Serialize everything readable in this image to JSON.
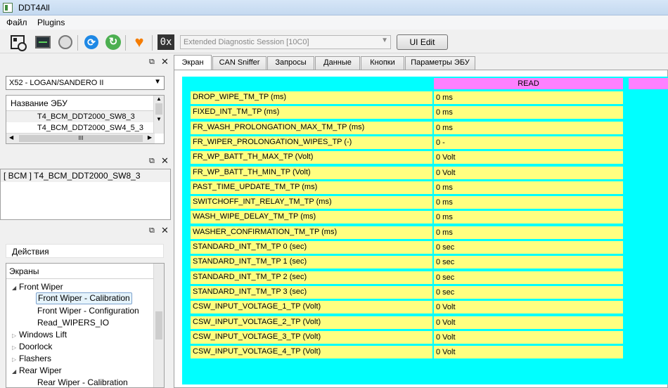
{
  "window": {
    "title": "DDT4All"
  },
  "menu": {
    "file": "Файл",
    "plugins": "Plugins"
  },
  "toolbar": {
    "session_value": "Extended Diagnostic Session [10C0]",
    "ui_edit_label": "UI Edit",
    "hex_label": "0x"
  },
  "vehicle": {
    "selected": "X52 - LOGAN/SANDERO II"
  },
  "ecu_list": {
    "header": "Название ЭБУ",
    "items": [
      "T4_BCM_DDT2000_SW8_3",
      "T4_BCM_DDT2000_SW4_5_3"
    ]
  },
  "scroll_glyph": "III",
  "connected": {
    "label": "[ BCM ] T4_BCM_DDT2000_SW8_3"
  },
  "actions": {
    "tab_label": "Действия",
    "tree_header": "Экраны",
    "tree": [
      "Front Wiper",
      "Front Wiper - Calibration",
      "Front Wiper - Configuration",
      "Read_WIPERS_IO",
      "Windows Lift",
      "Doorlock",
      "Flashers",
      "Rear Wiper",
      "Rear Wiper - Calibration"
    ]
  },
  "tabs": [
    "Экран",
    "CAN Sniffer",
    "Запросы",
    "Данные",
    "Кнопки",
    "Параметры ЭБУ"
  ],
  "screen": {
    "read_label": "READ",
    "params": [
      {
        "label": "DROP_WIPE_TM_TP (ms)",
        "value": "0 ms"
      },
      {
        "label": "FIXED_INT_TM_TP (ms)",
        "value": "0 ms"
      },
      {
        "label": "FR_WASH_PROLONGATION_MAX_TM_TP (ms)",
        "value": "0 ms"
      },
      {
        "label": "FR_WIPER_PROLONGATION_WIPES_TP (-)",
        "value": "0 -"
      },
      {
        "label": "FR_WP_BATT_TH_MAX_TP (Volt)",
        "value": "0 Volt"
      },
      {
        "label": "FR_WP_BATT_TH_MIN_TP (Volt)",
        "value": "0 Volt"
      },
      {
        "label": "PAST_TIME_UPDATE_TM_TP (ms)",
        "value": "0 ms"
      },
      {
        "label": "SWITCHOFF_INT_RELAY_TM_TP (ms)",
        "value": "0 ms"
      },
      {
        "label": "WASH_WIPE_DELAY_TM_TP (ms)",
        "value": "0 ms"
      },
      {
        "label": "WASHER_CONFIRMATION_TM_TP (ms)",
        "value": "0 ms"
      },
      {
        "label": "STANDARD_INT_TM_TP 0 (sec)",
        "value": "0 sec"
      },
      {
        "label": "STANDARD_INT_TM_TP 1 (sec)",
        "value": "0 sec"
      },
      {
        "label": "STANDARD_INT_TM_TP 2 (sec)",
        "value": "0 sec"
      },
      {
        "label": "STANDARD_INT_TM_TP 3 (sec)",
        "value": "0 sec"
      },
      {
        "label": "CSW_INPUT_VOLTAGE_1_TP (Volt)",
        "value": "0 Volt"
      },
      {
        "label": "CSW_INPUT_VOLTAGE_2_TP (Volt)",
        "value": "0 Volt"
      },
      {
        "label": "CSW_INPUT_VOLTAGE_3_TP (Volt)",
        "value": "0 Volt"
      },
      {
        "label": "CSW_INPUT_VOLTAGE_4_TP (Volt)",
        "value": "0 Volt"
      }
    ]
  },
  "colors": {
    "canvas": "#00ffff",
    "field": "#ffff80",
    "read_header": "#ff80ff"
  },
  "icons": [
    "qr-scan-icon",
    "monitor-icon",
    "robot-icon",
    "refresh-icon",
    "sync-icon",
    "heart-monitor-icon",
    "hex-icon"
  ]
}
